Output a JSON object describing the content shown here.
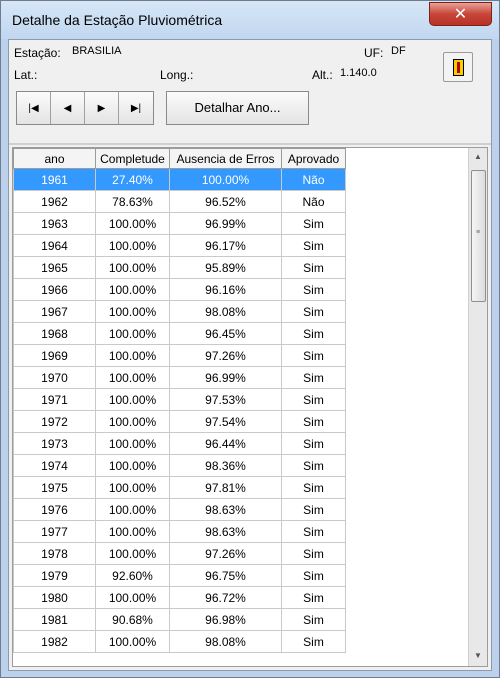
{
  "window": {
    "title": "Detalhe da Estação Pluviométrica",
    "close_glyph": "✕"
  },
  "station": {
    "estacao_label": "Estação:",
    "estacao_value": "BRASILIA",
    "uf_label": "UF:",
    "uf_value": "DF",
    "lat_label": "Lat.:",
    "long_label": "Long.:",
    "alt_label": "Alt.:",
    "alt_value": "1.140.0"
  },
  "toolbar": {
    "nav": [
      {
        "name": "first-record-button",
        "glyph": "|◀"
      },
      {
        "name": "previous-record-button",
        "glyph": "◀"
      },
      {
        "name": "next-record-button",
        "glyph": "▶"
      },
      {
        "name": "last-record-button",
        "glyph": "▶|"
      }
    ],
    "detalhar_label": "Detalhar Ano..."
  },
  "table": {
    "columns": [
      "ano",
      "Completude",
      "Ausencia de Erros",
      "Aprovado"
    ],
    "selected_index": 0,
    "rows": [
      [
        "1961",
        "27.40%",
        "100.00%",
        "Não"
      ],
      [
        "1962",
        "78.63%",
        "96.52%",
        "Não"
      ],
      [
        "1963",
        "100.00%",
        "96.99%",
        "Sim"
      ],
      [
        "1964",
        "100.00%",
        "96.17%",
        "Sim"
      ],
      [
        "1965",
        "100.00%",
        "95.89%",
        "Sim"
      ],
      [
        "1966",
        "100.00%",
        "96.16%",
        "Sim"
      ],
      [
        "1967",
        "100.00%",
        "98.08%",
        "Sim"
      ],
      [
        "1968",
        "100.00%",
        "96.45%",
        "Sim"
      ],
      [
        "1969",
        "100.00%",
        "97.26%",
        "Sim"
      ],
      [
        "1970",
        "100.00%",
        "96.99%",
        "Sim"
      ],
      [
        "1971",
        "100.00%",
        "97.53%",
        "Sim"
      ],
      [
        "1972",
        "100.00%",
        "97.54%",
        "Sim"
      ],
      [
        "1973",
        "100.00%",
        "96.44%",
        "Sim"
      ],
      [
        "1974",
        "100.00%",
        "98.36%",
        "Sim"
      ],
      [
        "1975",
        "100.00%",
        "97.81%",
        "Sim"
      ],
      [
        "1976",
        "100.00%",
        "98.63%",
        "Sim"
      ],
      [
        "1977",
        "100.00%",
        "98.63%",
        "Sim"
      ],
      [
        "1978",
        "100.00%",
        "97.26%",
        "Sim"
      ],
      [
        "1979",
        "92.60%",
        "96.75%",
        "Sim"
      ],
      [
        "1980",
        "100.00%",
        "96.72%",
        "Sim"
      ],
      [
        "1981",
        "90.68%",
        "96.98%",
        "Sim"
      ],
      [
        "1982",
        "100.00%",
        "98.08%",
        "Sim"
      ]
    ]
  },
  "scrollbar": {
    "up_glyph": "▲",
    "down_glyph": "▼",
    "position_fraction": 0.0
  },
  "colors": {
    "selection": "#3399ff",
    "title_bar": "#c1d7f0",
    "close_button": "#c7463a"
  }
}
